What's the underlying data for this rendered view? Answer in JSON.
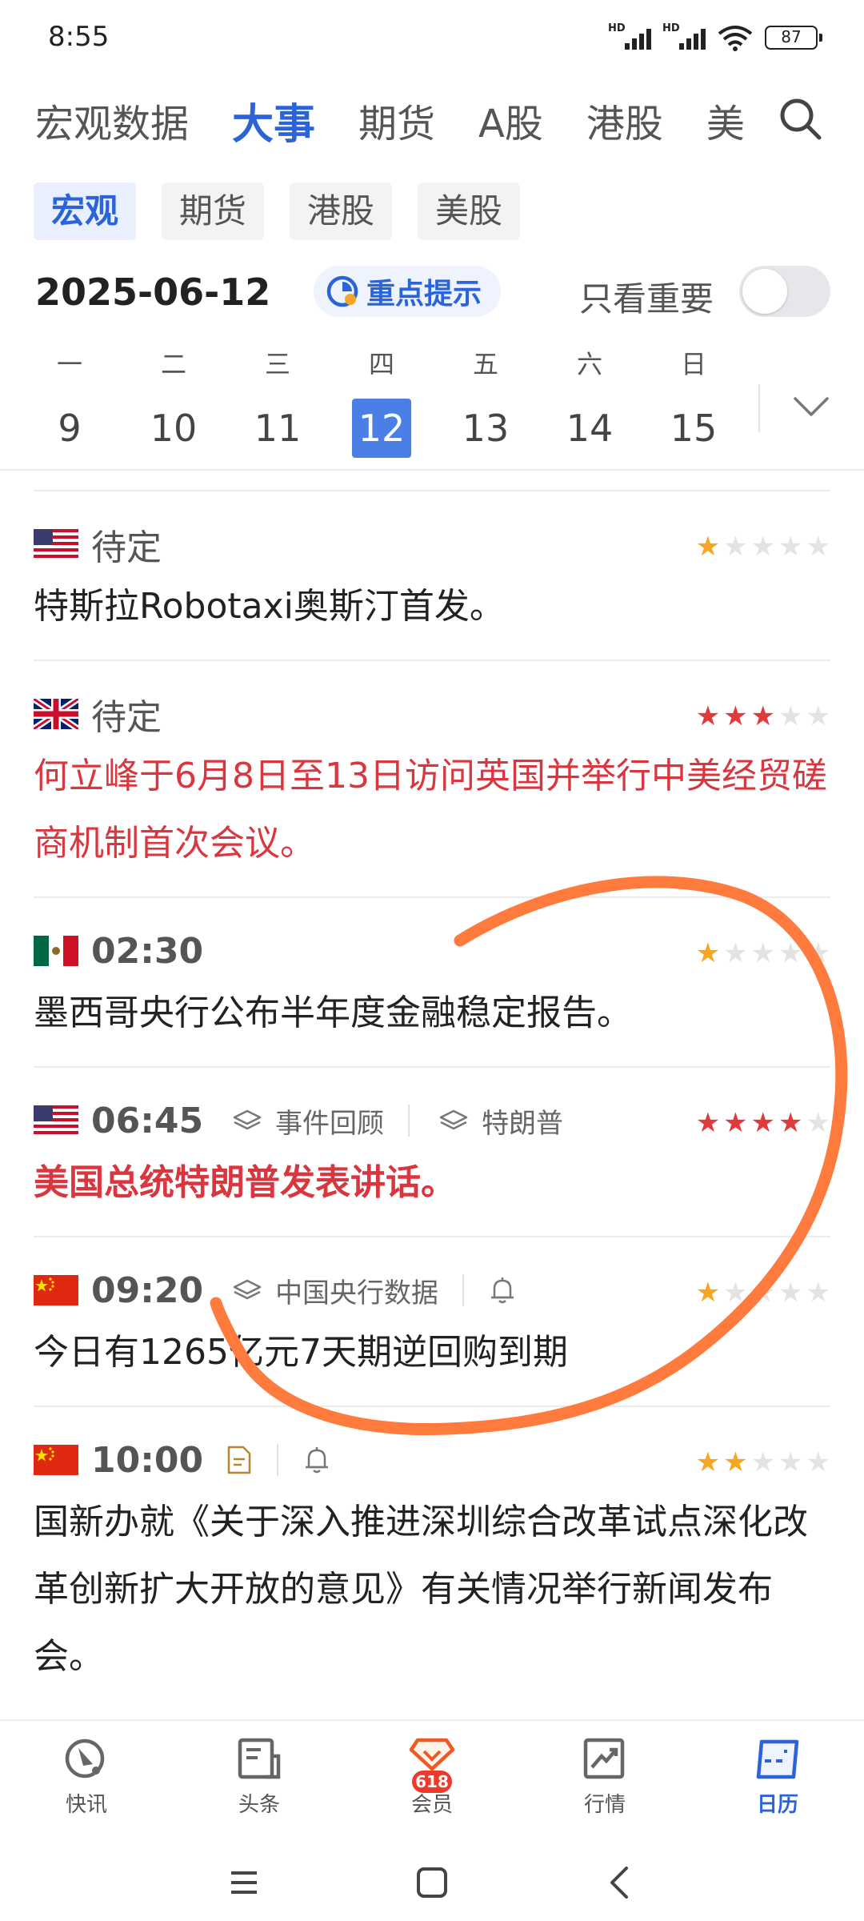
{
  "status": {
    "time": "8:55",
    "battery": "87",
    "hd1": "HD",
    "hd2": "HD"
  },
  "top_tabs": [
    {
      "label": "宏观数据",
      "active": false
    },
    {
      "label": "大事",
      "active": true
    },
    {
      "label": "期货",
      "active": false
    },
    {
      "label": "A股",
      "active": false
    },
    {
      "label": "港股",
      "active": false
    },
    {
      "label": "美",
      "active": false
    }
  ],
  "sub_tabs": [
    {
      "label": "宏观",
      "active": true
    },
    {
      "label": "期货",
      "active": false
    },
    {
      "label": "港股",
      "active": false
    },
    {
      "label": "美股",
      "active": false
    }
  ],
  "date": "2025-06-12",
  "key_tip": "重点提示",
  "only_important": {
    "label": "只看重要",
    "on": false
  },
  "week": [
    {
      "wd": "一",
      "dn": "9"
    },
    {
      "wd": "二",
      "dn": "10"
    },
    {
      "wd": "三",
      "dn": "11"
    },
    {
      "wd": "四",
      "dn": "12"
    },
    {
      "wd": "五",
      "dn": "13"
    },
    {
      "wd": "六",
      "dn": "14"
    },
    {
      "wd": "日",
      "dn": "15"
    }
  ],
  "selected_day": "12",
  "events": [
    {
      "flag": "us",
      "time": "待定",
      "stars": 1,
      "star_color": "#f5a623",
      "text": "特斯拉Robotaxi奥斯汀首发。"
    },
    {
      "flag": "uk",
      "time": "待定",
      "stars": 3,
      "star_color": "#e03b3b",
      "text": "何立峰于6月8日至13日访问英国并举行中美经贸磋商机制首次会议。"
    },
    {
      "flag": "mx",
      "time": "02:30",
      "stars": 1,
      "star_color": "#f5a623",
      "text": "墨西哥央行公布半年度金融稳定报告。"
    },
    {
      "flag": "us",
      "time": "06:45",
      "stars": 4,
      "star_color": "#e03b3b",
      "tags": [
        "事件回顾",
        "特朗普"
      ],
      "text": "美国总统特朗普发表讲话。"
    },
    {
      "flag": "cn",
      "time": "09:20",
      "stars": 1,
      "star_color": "#f5a623",
      "tags": [
        "中国央行数据"
      ],
      "text": "今日有1265亿元7天期逆回购到期"
    },
    {
      "flag": "cn",
      "time": "10:00",
      "stars": 2,
      "star_color": "#f5a623",
      "text": "国新办就《关于深入推进深圳综合改革试点深化改革创新扩大开放的意见》有关情况举行新闻发布会。"
    }
  ],
  "bottom_nav": [
    {
      "label": "快讯",
      "icon": "flash-news-icon",
      "active": false
    },
    {
      "label": "头条",
      "icon": "headline-icon",
      "active": false
    },
    {
      "label": "会员",
      "icon": "vip-icon",
      "active": false,
      "badge": "618"
    },
    {
      "label": "行情",
      "icon": "market-icon",
      "active": false
    },
    {
      "label": "日历",
      "icon": "calendar-icon",
      "active": true
    }
  ],
  "colors": {
    "accent": "#2b63d9",
    "red": "#d9373f",
    "star_yellow": "#f5a623",
    "star_red": "#e03b3b",
    "annotation": "#ff7a3d"
  }
}
